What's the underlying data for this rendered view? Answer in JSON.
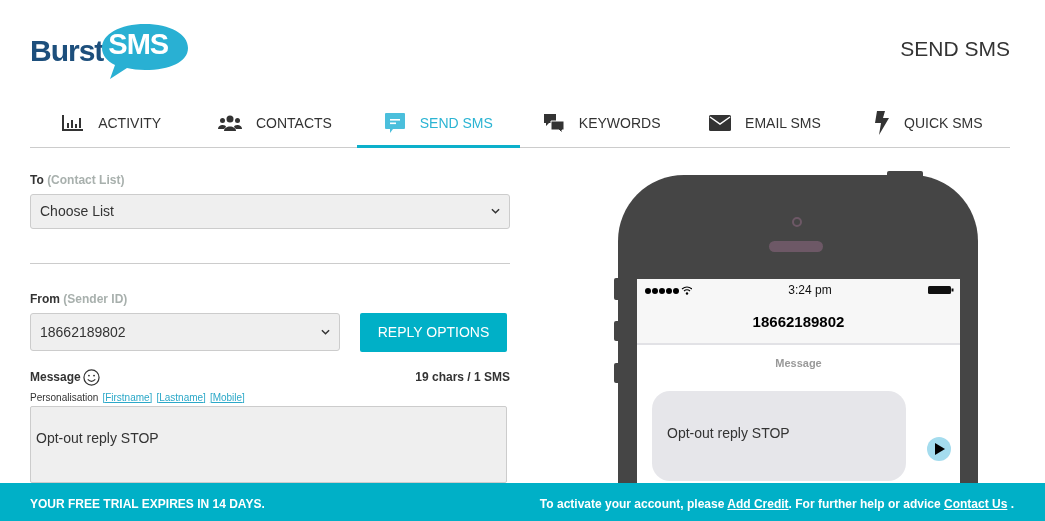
{
  "logo": {
    "word": "Burst",
    "badge": "SMS"
  },
  "page_title": "SEND SMS",
  "tabs": [
    {
      "label": "ACTIVITY",
      "kind": "chart",
      "selected": false
    },
    {
      "label": "CONTACTS",
      "kind": "people",
      "selected": false
    },
    {
      "label": "SEND SMS",
      "kind": "chat",
      "selected": true
    },
    {
      "label": "KEYWORDS",
      "kind": "chats",
      "selected": false
    },
    {
      "label": "EMAIL SMS",
      "kind": "envelope",
      "selected": false
    },
    {
      "label": "QUICK SMS",
      "kind": "bolt",
      "selected": false
    }
  ],
  "form": {
    "to": {
      "label": "To",
      "hint": "(Contact List)",
      "value": "Choose List"
    },
    "from": {
      "label": "From",
      "hint": "(Sender ID)",
      "value": "18662189802"
    },
    "reply_button": "REPLY OPTIONS",
    "message": {
      "label": "Message",
      "counter": "19 chars / 1 SMS",
      "personalisation_label": "Personalisation",
      "tags": [
        "[Firstname]",
        "[Lastname]",
        "[Mobile]"
      ],
      "value": "Opt-out reply STOP"
    }
  },
  "phone": {
    "time": "3:24 pm",
    "contact": "18662189802",
    "thread_label": "Message",
    "bubble": "Opt-out reply STOP"
  },
  "footer": {
    "trial": "YOUR FREE TRIAL EXPIRES IN 14 DAYS.",
    "activate_text": "To activate your account, please",
    "add_credit": "Add Credit",
    "help_text": ". For further help or advice",
    "contact_us": "Contact Us",
    "end": "."
  }
}
